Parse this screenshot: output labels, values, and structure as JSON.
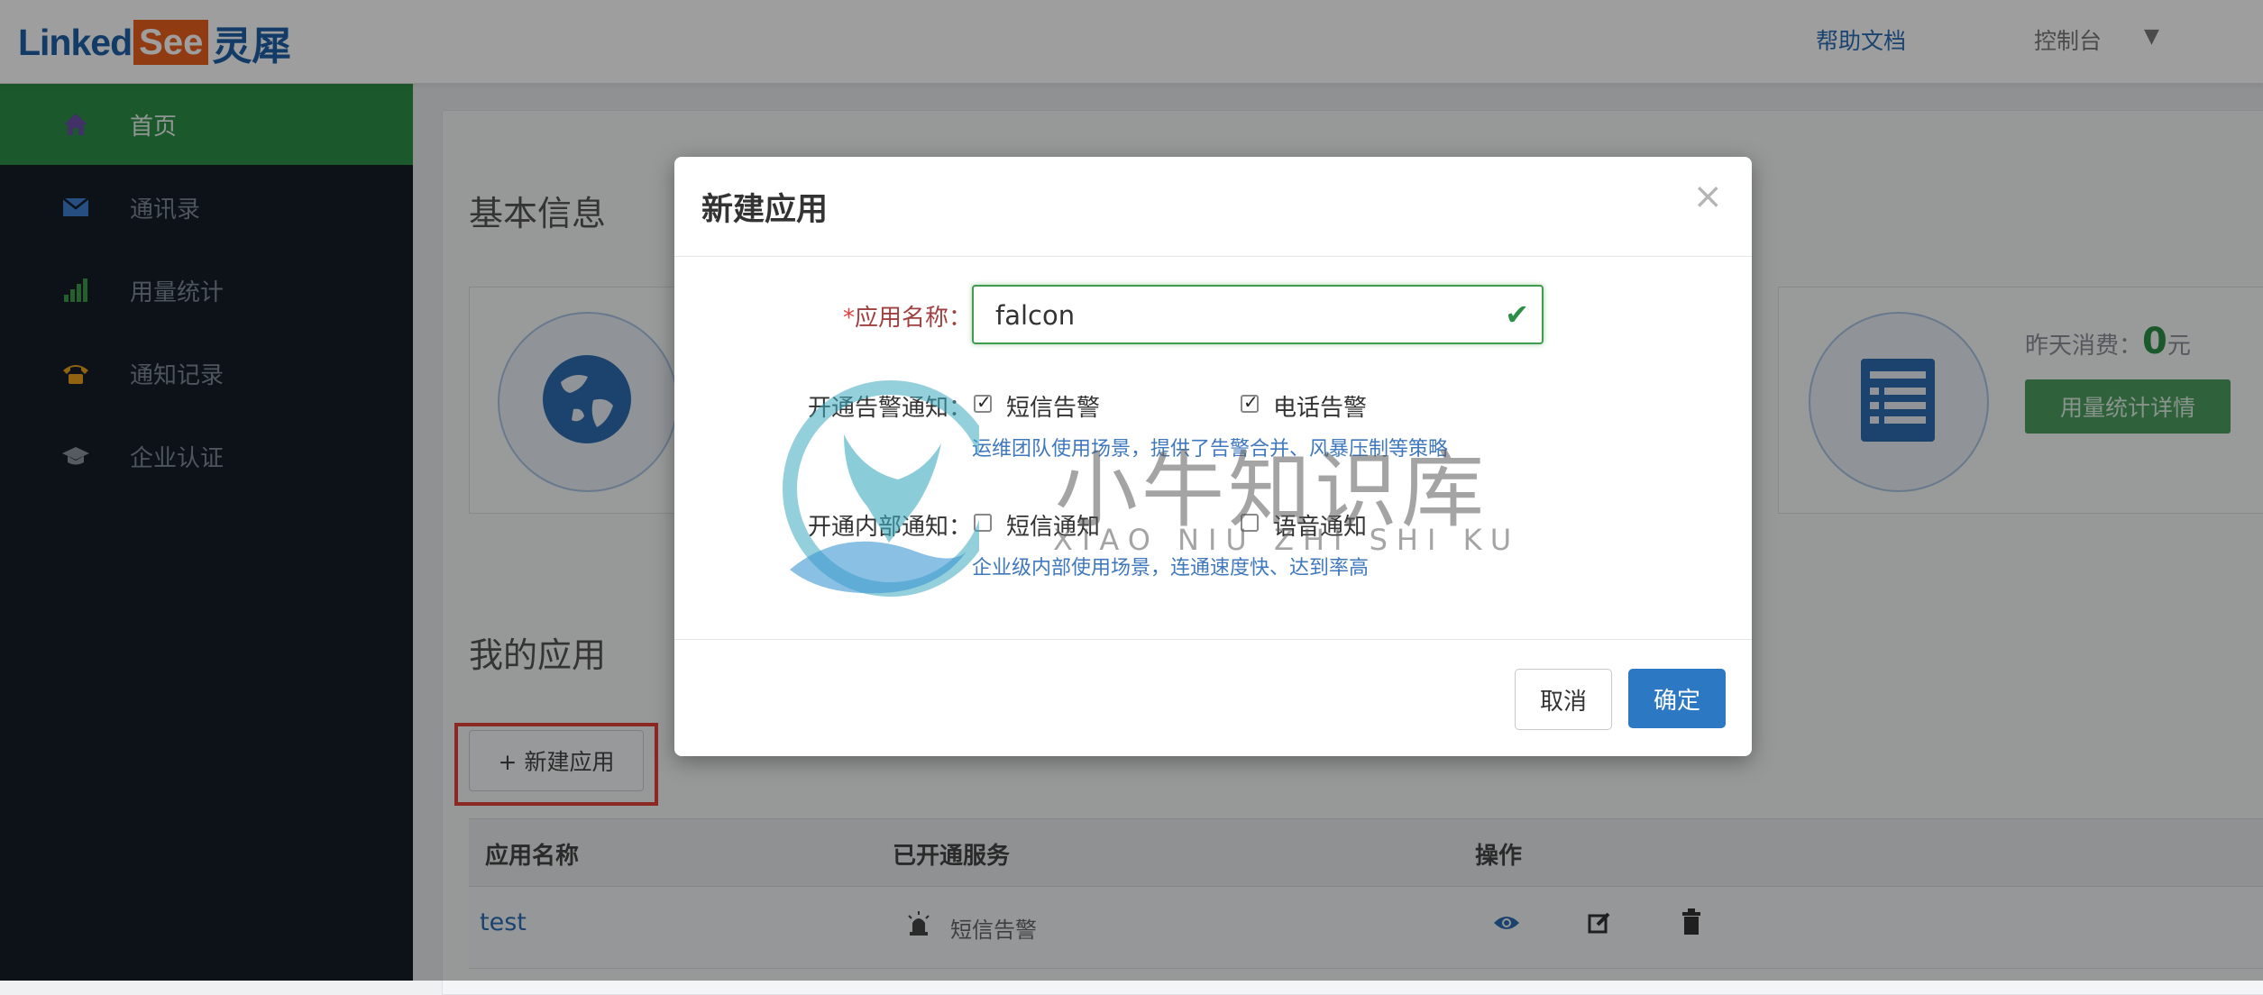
{
  "header": {
    "logo_linked": "Linked",
    "logo_see": "See",
    "logo_cn": "灵犀",
    "help_link": "帮助文档",
    "console_link": "控制台",
    "console_caret": "▼"
  },
  "sidebar": {
    "items": [
      {
        "label": "首页",
        "icon": "home-icon",
        "active": true
      },
      {
        "label": "通讯录",
        "icon": "envelope-icon",
        "active": false
      },
      {
        "label": "用量统计",
        "icon": "signal-bars-icon",
        "active": false
      },
      {
        "label": "通知记录",
        "icon": "phone-icon",
        "active": false
      },
      {
        "label": "企业认证",
        "icon": "graduation-cap-icon",
        "active": false
      }
    ]
  },
  "main": {
    "basic_info_title": "基本信息",
    "yesterday_label": "昨天消费：",
    "yesterday_value": "0",
    "yesterday_unit": "元",
    "usage_details_button": "用量统计详情",
    "my_apps_title": "我的应用",
    "new_app_button": "+ 新建应用",
    "table": {
      "headers": [
        "应用名称",
        "已开通服务",
        "操作"
      ],
      "rows": [
        {
          "name": "test",
          "service": "短信告警",
          "service_icon": "alarm-light-icon",
          "actions": [
            "eye-icon",
            "edit-icon",
            "trash-icon"
          ]
        }
      ]
    }
  },
  "modal": {
    "title": "新建应用",
    "close": "×",
    "name_required_mark": "*",
    "name_label": "应用名称：",
    "name_value": "falcon",
    "alert_label": "开通告警通知：",
    "alert_options": [
      {
        "label": "短信告警",
        "checked": true
      },
      {
        "label": "电话告警",
        "checked": true
      }
    ],
    "alert_hint": "运维团队使用场景，提供了告警合并、风暴压制等策略",
    "internal_label": "开通内部通知：",
    "internal_options": [
      {
        "label": "短信通知",
        "checked": false
      },
      {
        "label": "语音通知",
        "checked": false
      }
    ],
    "internal_hint": "企业级内部使用场景，连通速度快、达到率高",
    "cancel_button": "取消",
    "ok_button": "确定"
  },
  "watermark": {
    "text": "小牛知识库",
    "sub": "XIAO NIU ZHI SHI KU"
  },
  "colors": {
    "brand_blue": "#1d5fa7",
    "brand_orange": "#e8601c",
    "sidebar_bg": "#141d26",
    "active_green": "#2c8f46",
    "primary_blue": "#2c78c3",
    "highlight_red": "#e2403a"
  }
}
